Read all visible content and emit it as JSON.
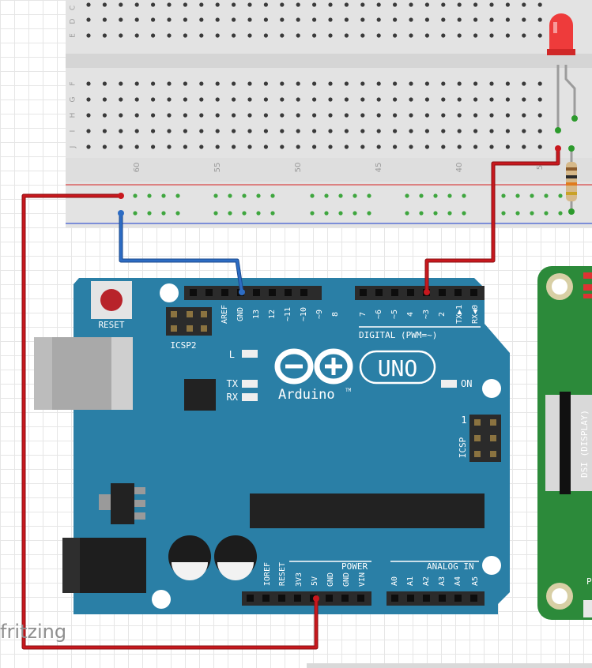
{
  "breadboard": {
    "row_letters_top": [
      "C",
      "D",
      "E"
    ],
    "row_letters_bottom": [
      "F",
      "G",
      "H",
      "I",
      "J"
    ],
    "column_numbers": [
      "60",
      "55",
      "50",
      "45",
      "40",
      "5"
    ]
  },
  "arduino": {
    "reset_label": "RESET",
    "icsp2_label": "ICSP2",
    "icsp_label": "ICSP",
    "icsp_pin1": "1",
    "led_l": "L",
    "led_tx": "TX",
    "led_rx": "RX",
    "on_label": "ON",
    "brand": "Arduino",
    "trademark": "TM",
    "model": "UNO",
    "digital_label": "DIGITAL (PWM=~)",
    "power_label": "POWER",
    "analog_label": "ANALOG IN",
    "digital_pins_left": [
      "AREF",
      "GND",
      "13",
      "12",
      "~11",
      "~10",
      "~9",
      "8"
    ],
    "digital_pins_right": [
      "7",
      "~6",
      "~5",
      "4",
      "~3",
      "2",
      "TX▶1",
      "RX◀0"
    ],
    "power_pins": [
      "IOREF",
      "RESET",
      "3V3",
      "5V",
      "GND",
      "GND",
      "VIN"
    ],
    "analog_pins": [
      "A0",
      "A1",
      "A2",
      "A3",
      "A4",
      "A5"
    ]
  },
  "pi_board": {
    "dsi_label": "DSI (DISPLAY)",
    "edge_letter": "P"
  },
  "watermark": "fritzing",
  "colors": {
    "arduino_blue": "#2a7fa6",
    "breadboard": "#e3e3e3",
    "wire_red": "#c8181e",
    "wire_blue": "#2d6cc3",
    "led_red": "#ee3b3b",
    "pi_green": "#2c8a3a"
  }
}
